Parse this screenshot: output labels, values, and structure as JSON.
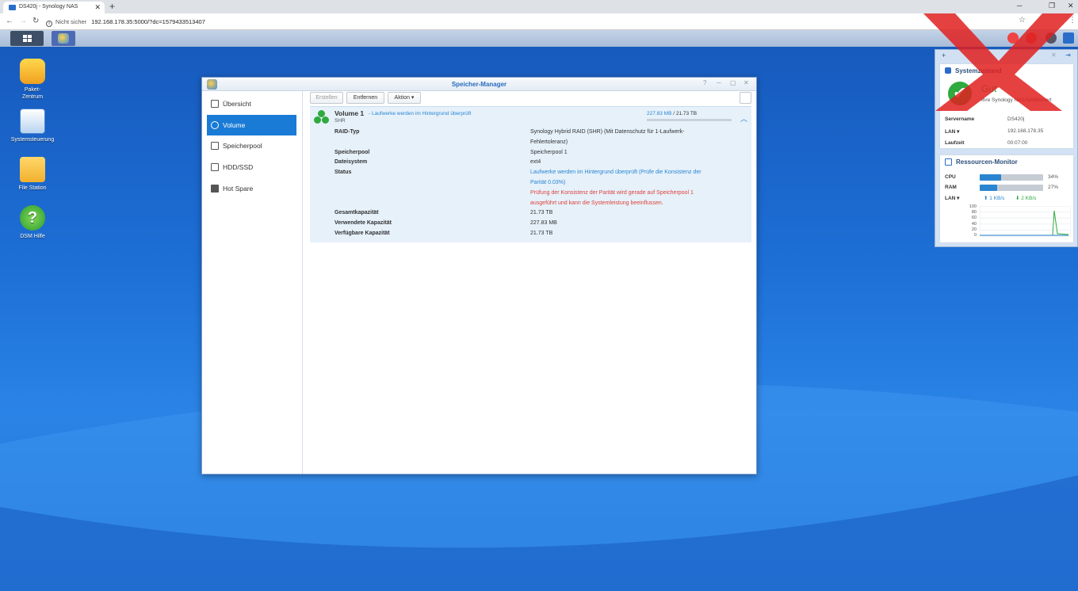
{
  "browser": {
    "tab_title": "DS420j - Synology NAS",
    "new_tab": "+",
    "security": "Nicht sicher",
    "url": "192.168.178.35:5000/?dc=1579433513407"
  },
  "desktop_icons": [
    {
      "label": "Paket-\nZentrum"
    },
    {
      "label": "Systemsteuerung"
    },
    {
      "label": "File Station"
    },
    {
      "label": "DSM Hilfe"
    }
  ],
  "window": {
    "title": "Speicher-Manager",
    "help": "?",
    "sidebar": [
      {
        "label": "Übersicht"
      },
      {
        "label": "Volume"
      },
      {
        "label": "Speicherpool"
      },
      {
        "label": "HDD/SSD"
      },
      {
        "label": "Hot Spare"
      }
    ],
    "toolbar": {
      "create": "Erstellen",
      "remove": "Entfernen",
      "action": "Aktion ▾"
    },
    "volume": {
      "name": "Volume 1",
      "sub": "- Laufwerke werden im Hintergrund überprüft",
      "type": "SHR",
      "used": "227.83 MB",
      "total": "/ 21.73 TB",
      "usage_fraction": 0.0,
      "rows": [
        {
          "label": "RAID-Typ",
          "value": "Synology Hybrid RAID (SHR) (Mit Datenschutz für 1-Laufwerk-"
        },
        {
          "label": "",
          "value": "Fehlertoleranz)"
        },
        {
          "label": "Speicherpool",
          "value": "Speicherpool 1"
        },
        {
          "label": "Dateisystem",
          "value": "ext4"
        },
        {
          "label": "Status",
          "value": "Laufwerke werden im Hintergrund überprüft (Prüfe die Konsistenz der"
        },
        {
          "label": "",
          "value": "Parität 0.03%)"
        },
        {
          "label": "",
          "value": "Prüfung der Konsistenz der Parität wird gerade auf Speicherpool 1"
        },
        {
          "label": "",
          "value": "ausgeführt und kann die Systemleistung beeinflussen."
        },
        {
          "label": "Gesamtkapazität",
          "value": "21.73 TB"
        },
        {
          "label": "Verwendete Kapazität",
          "value": "227.83 MB"
        },
        {
          "label": "Verfügbare Kapazität",
          "value": "21.73 TB"
        }
      ]
    }
  },
  "widgets": {
    "health": {
      "title": "Systemzustand",
      "status": "Gut",
      "status_sub": "Ihre Synology NAS funktioniert",
      "rows": [
        {
          "label": "Servername",
          "value": "DS420j"
        },
        {
          "label": "LAN ▾",
          "value": "192.168.178.35"
        },
        {
          "label": "Laufzeit",
          "value": "00:07:00"
        }
      ]
    },
    "monitor": {
      "title": "Ressourcen-Monitor",
      "cpu_label": "CPU",
      "cpu": 34,
      "cpu_text": "34%",
      "ram_label": "RAM",
      "ram": 27,
      "ram_text": "27%",
      "lan_label": "LAN ▾",
      "up": "1 KB/s",
      "down": "2 KB/s",
      "y_ticks": [
        "100",
        "80",
        "60",
        "40",
        "20",
        "0"
      ]
    }
  },
  "colors": {
    "accent": "#1a7bd6",
    "ok": "#2eaa3f",
    "warn_red": "#e0423a"
  }
}
